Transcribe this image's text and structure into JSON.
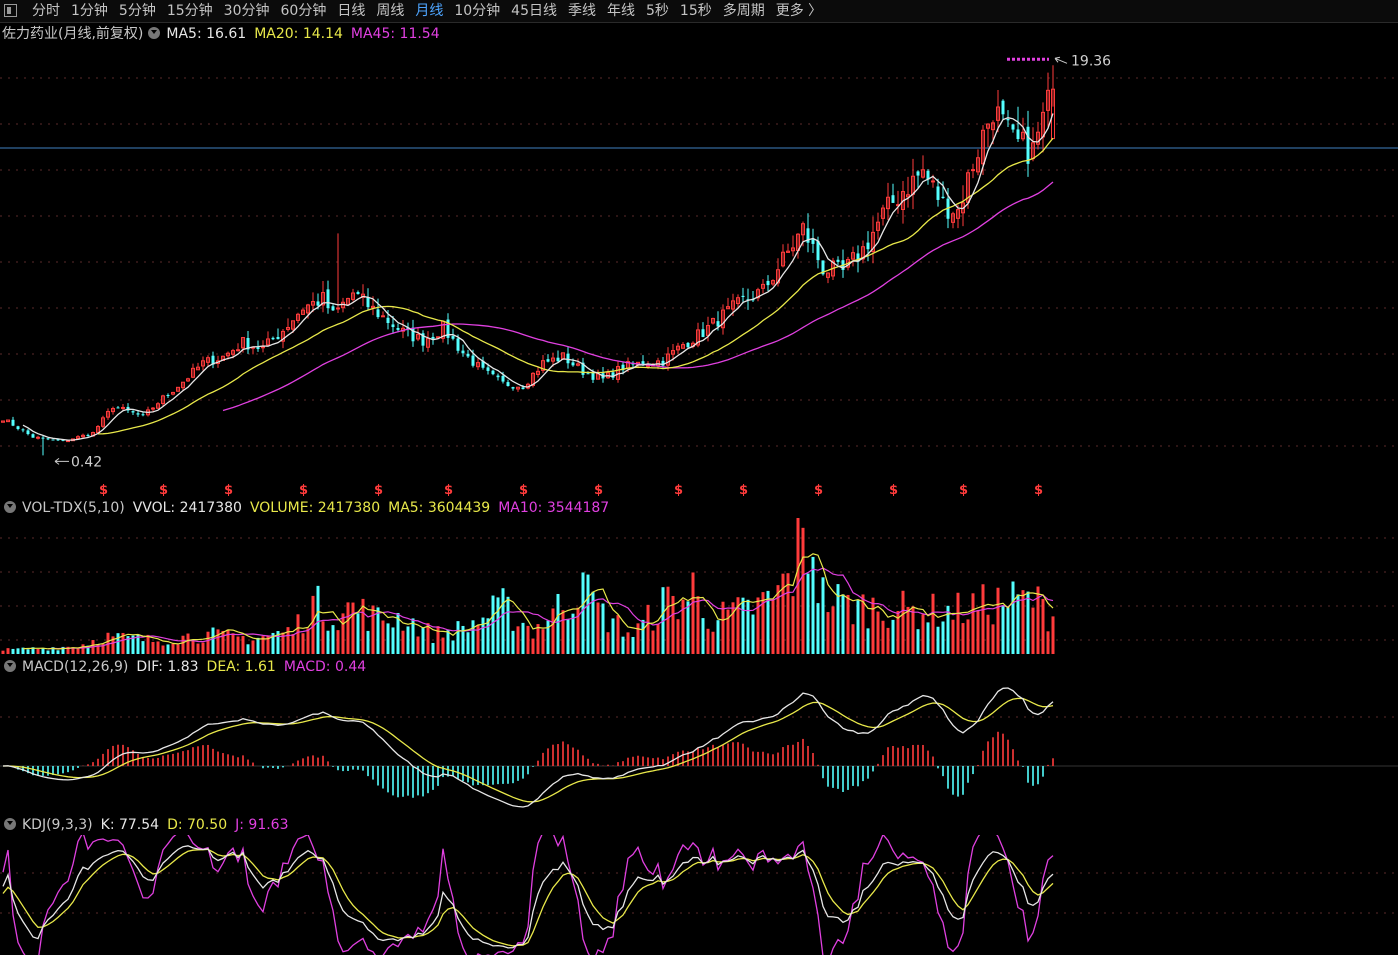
{
  "toolbar": {
    "tabs": [
      {
        "label": "分时"
      },
      {
        "label": "1分钟"
      },
      {
        "label": "5分钟"
      },
      {
        "label": "15分钟"
      },
      {
        "label": "30分钟"
      },
      {
        "label": "60分钟"
      },
      {
        "label": "日线"
      },
      {
        "label": "周线"
      },
      {
        "label": "月线",
        "active": true
      },
      {
        "label": "10分钟"
      },
      {
        "label": "45日线"
      },
      {
        "label": "季线"
      },
      {
        "label": "年线"
      },
      {
        "label": "5秒"
      },
      {
        "label": "15秒"
      },
      {
        "label": "多周期"
      },
      {
        "label": "更多 〉"
      }
    ]
  },
  "main": {
    "title": "佐力药业(月线,前复权)",
    "ma5": "MA5: 16.61",
    "ma20": "MA20: 14.14",
    "ma45": "MA45: 11.54",
    "high_label": "19.36",
    "low_label": "0.42",
    "marker_glyph": "$"
  },
  "vol": {
    "title": "VOL-TDX(5,10)",
    "vvol": "VVOL: 2417380",
    "volume": "VOLUME: 2417380",
    "ma5": "MA5: 3604439",
    "ma10": "MA10: 3544187"
  },
  "macd": {
    "title": "MACD(12,26,9)",
    "dif": "DIF: 1.83",
    "dea": "DEA: 1.61",
    "macd": "MACD: 0.44"
  },
  "kdj": {
    "title": "KDJ(9,3,3)",
    "k": "K: 77.54",
    "d": "D: 70.50",
    "j": "J: 91.63"
  },
  "colors": {
    "up": "#ff3b3b",
    "down": "#54ffff",
    "ma5": "#e6e6e6",
    "ma20": "#e8e84a",
    "ma45": "#e040e0",
    "active_tab": "#4ea5ff",
    "ref_line": "#3f7fbf"
  },
  "chart_data": {
    "type": "candlestick",
    "period": "monthly",
    "price_range_visible": [
      0.42,
      19.36
    ],
    "waypoints_close": [
      [
        0,
        2.2
      ],
      [
        6,
        1.3
      ],
      [
        12,
        1.1
      ],
      [
        18,
        1.5
      ],
      [
        22,
        2.8
      ],
      [
        28,
        2.3
      ],
      [
        32,
        3.2
      ],
      [
        36,
        4.0
      ],
      [
        40,
        4.9
      ],
      [
        44,
        5.2
      ],
      [
        48,
        5.9
      ],
      [
        52,
        5.6
      ],
      [
        56,
        6.5
      ],
      [
        60,
        7.6
      ],
      [
        64,
        8.0
      ],
      [
        66,
        7.2
      ],
      [
        70,
        8.3
      ],
      [
        74,
        7.5
      ],
      [
        80,
        6.4
      ],
      [
        84,
        6.0
      ],
      [
        88,
        6.6
      ],
      [
        92,
        5.4
      ],
      [
        96,
        4.5
      ],
      [
        100,
        3.9
      ],
      [
        104,
        3.8
      ],
      [
        108,
        4.9
      ],
      [
        112,
        5.2
      ],
      [
        116,
        4.5
      ],
      [
        120,
        4.1
      ],
      [
        124,
        4.7
      ],
      [
        128,
        4.9
      ],
      [
        132,
        5.0
      ],
      [
        136,
        5.8
      ],
      [
        140,
        6.4
      ],
      [
        144,
        7.2
      ],
      [
        148,
        7.9
      ],
      [
        152,
        8.4
      ],
      [
        156,
        9.9
      ],
      [
        160,
        11.4
      ],
      [
        164,
        9.5
      ],
      [
        168,
        9.3
      ],
      [
        172,
        10.4
      ],
      [
        176,
        12.1
      ],
      [
        180,
        13.3
      ],
      [
        184,
        14.2
      ],
      [
        188,
        12.6
      ],
      [
        191,
        12.3
      ],
      [
        194,
        14.6
      ],
      [
        198,
        17.3
      ],
      [
        202,
        15.6
      ],
      [
        206,
        15.2
      ],
      [
        208,
        16.7
      ],
      [
        210,
        18.2
      ]
    ],
    "vol_waypoints": [
      [
        0,
        0.2
      ],
      [
        15,
        0.4
      ],
      [
        20,
        0.9
      ],
      [
        30,
        0.7
      ],
      [
        40,
        1.0
      ],
      [
        50,
        0.8
      ],
      [
        58,
        1.2
      ],
      [
        62,
        2.6
      ],
      [
        66,
        2.0
      ],
      [
        70,
        2.4
      ],
      [
        75,
        1.8
      ],
      [
        80,
        1.9
      ],
      [
        86,
        1.0
      ],
      [
        92,
        1.3
      ],
      [
        100,
        2.4
      ],
      [
        106,
        1.2
      ],
      [
        112,
        2.6
      ],
      [
        116,
        3.3
      ],
      [
        120,
        2.0
      ],
      [
        126,
        1.0
      ],
      [
        132,
        2.6
      ],
      [
        138,
        2.9
      ],
      [
        142,
        1.8
      ],
      [
        148,
        2.2
      ],
      [
        154,
        2.8
      ],
      [
        158,
        4.2
      ],
      [
        160,
        6.5
      ],
      [
        164,
        3.0
      ],
      [
        170,
        2.4
      ],
      [
        176,
        2.4
      ],
      [
        182,
        2.2
      ],
      [
        190,
        2.2
      ],
      [
        196,
        2.5
      ],
      [
        200,
        2.7
      ],
      [
        206,
        2.8
      ],
      [
        210,
        1.9
      ]
    ]
  }
}
